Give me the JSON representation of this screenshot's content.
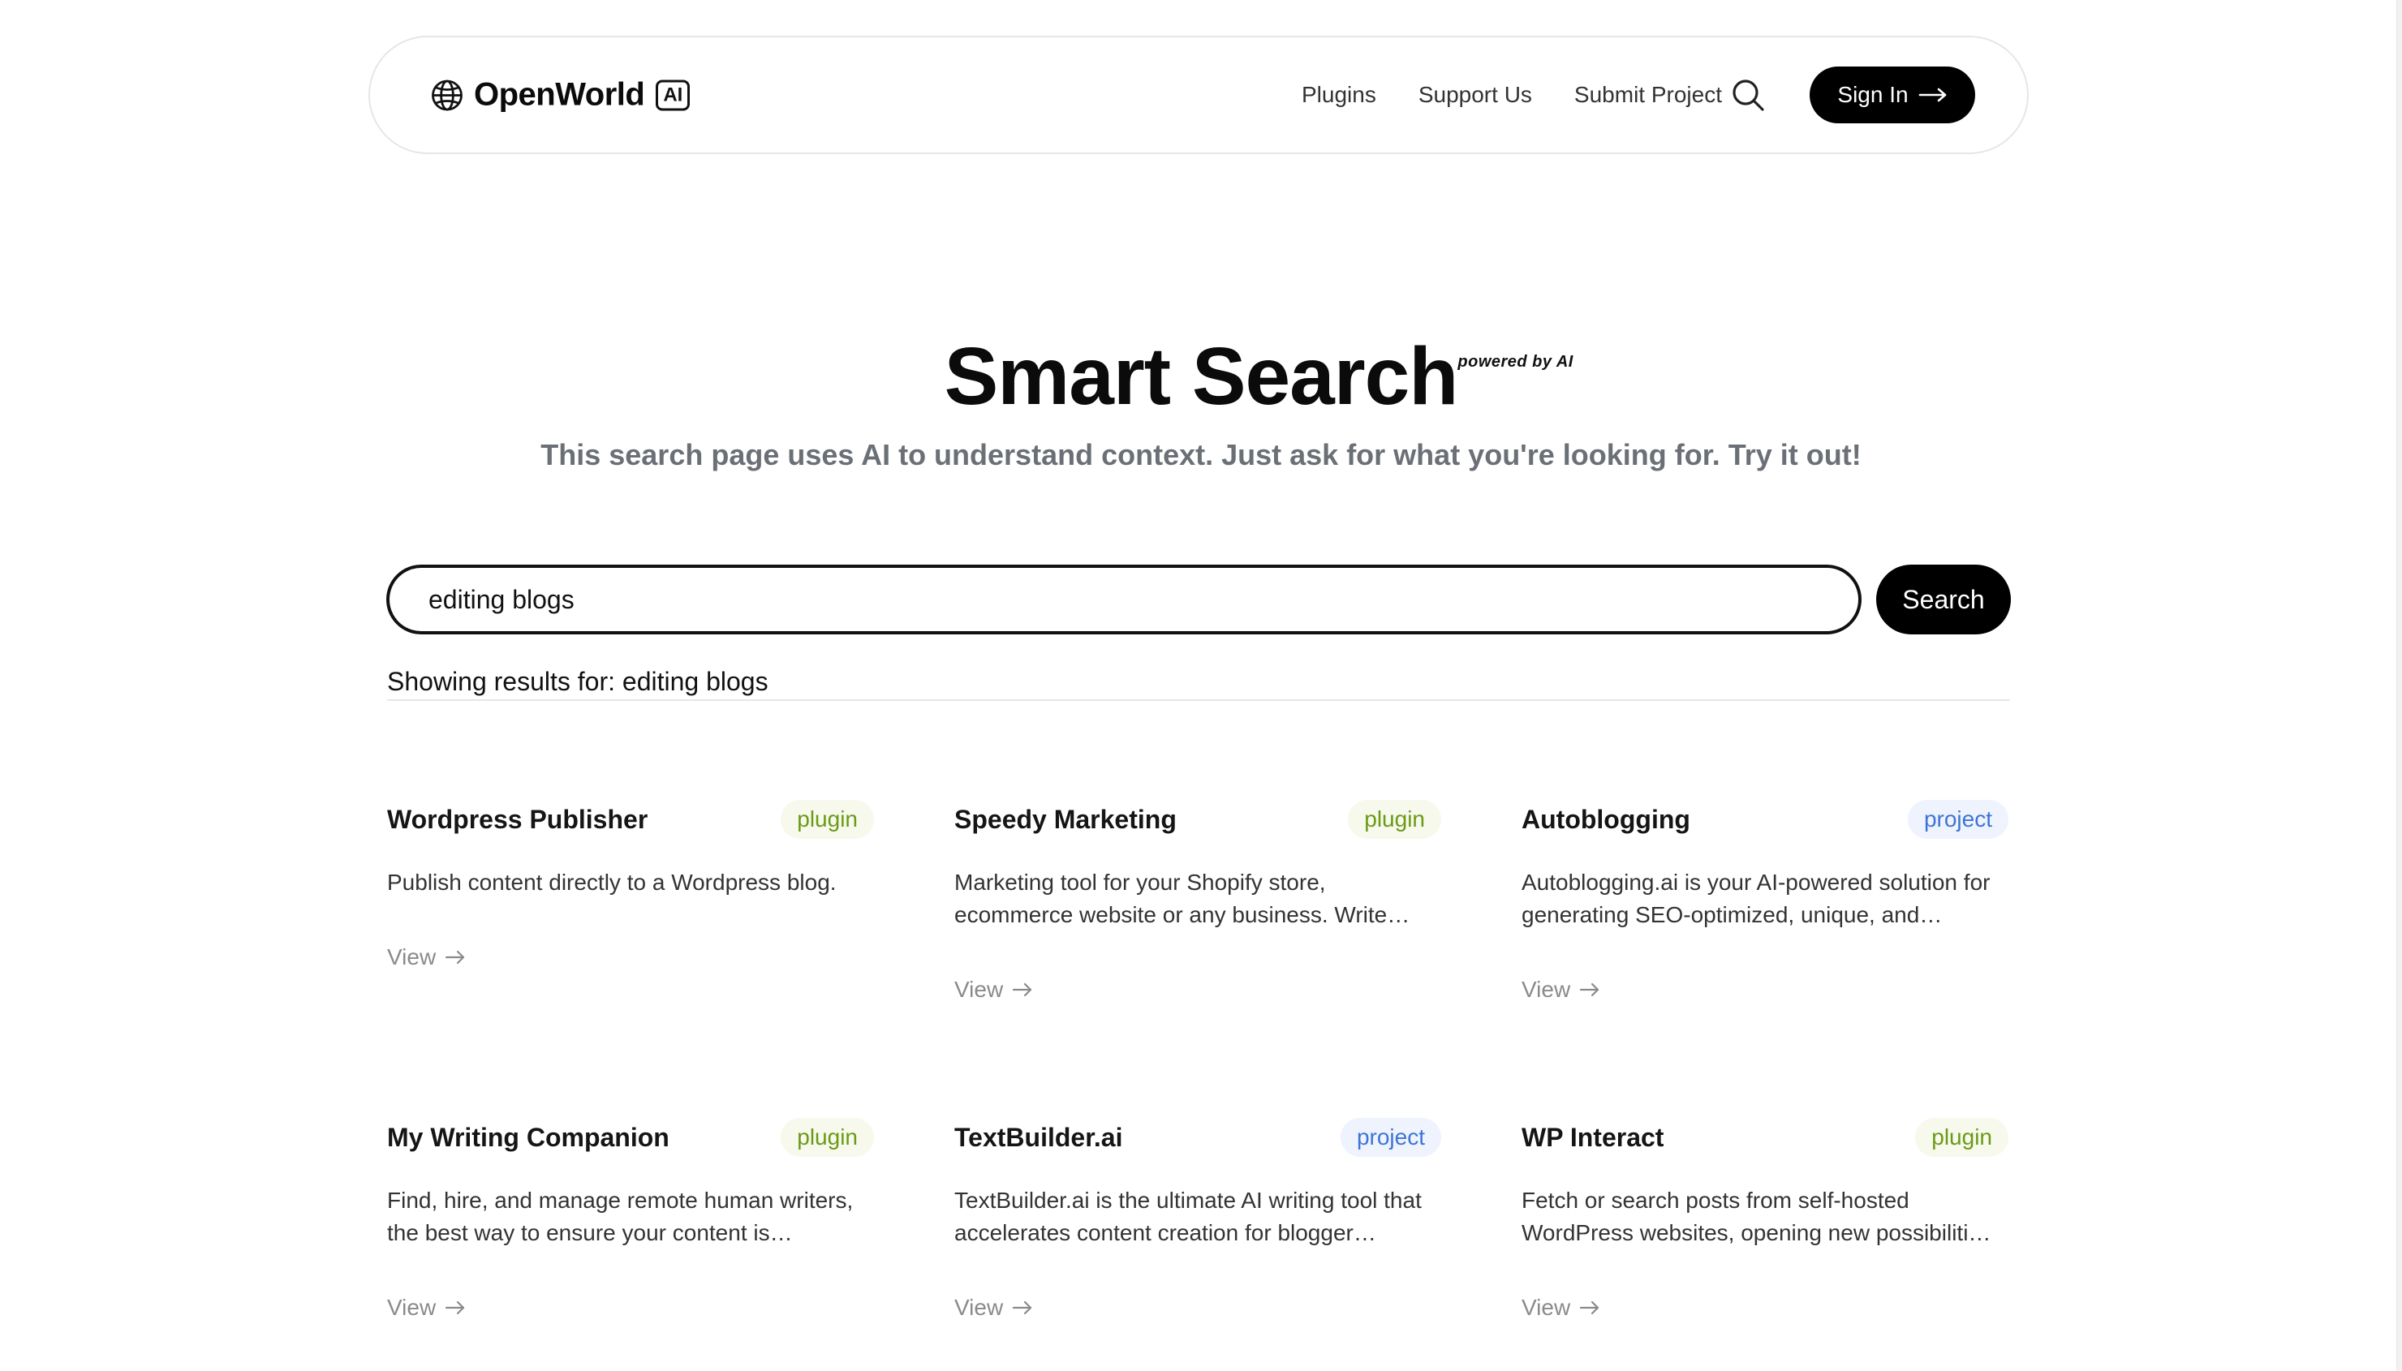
{
  "nav": {
    "brand": "OpenWorld",
    "brand_badge": "AI",
    "links": [
      "Plugins",
      "Support Us",
      "Submit Project"
    ],
    "signin_label": "Sign In"
  },
  "hero": {
    "title": "Smart Search",
    "powered_by": "powered by AI",
    "subtitle": "This search page uses AI to understand context. Just ask for what you're looking for. Try it out!"
  },
  "search": {
    "value": "editing blogs",
    "button_label": "Search",
    "results_label": "Showing results for: editing blogs"
  },
  "results": [
    {
      "title": "Wordpress Publisher",
      "type": "plugin",
      "description": "Publish content directly to a Wordpress blog.",
      "link_label": "View"
    },
    {
      "title": "Speedy Marketing",
      "type": "plugin",
      "description": "Marketing tool for your Shopify store, ecommerce website or any business. Write…",
      "link_label": "View"
    },
    {
      "title": "Autoblogging",
      "type": "project",
      "description": "Autoblogging.ai is your AI-powered solution for generating SEO-optimized, unique, and…",
      "link_label": "View"
    },
    {
      "title": "My Writing Companion",
      "type": "plugin",
      "description": "Find, hire, and manage remote human writers, the best way to ensure your content is…",
      "link_label": "View"
    },
    {
      "title": "TextBuilder.ai",
      "type": "project",
      "description": "TextBuilder.ai is the ultimate AI writing tool that accelerates content creation for blogger…",
      "link_label": "View"
    },
    {
      "title": "WP Interact",
      "type": "plugin",
      "description": "Fetch or search posts from self-hosted WordPress websites, opening new possibiliti…",
      "link_label": "View"
    }
  ],
  "colors": {
    "plugin_badge_text": "#6b9a16",
    "plugin_badge_bg": "#f6f9ec",
    "project_badge_text": "#3e74d6",
    "project_badge_bg": "#eef3fd",
    "primary_button": "#000000"
  }
}
